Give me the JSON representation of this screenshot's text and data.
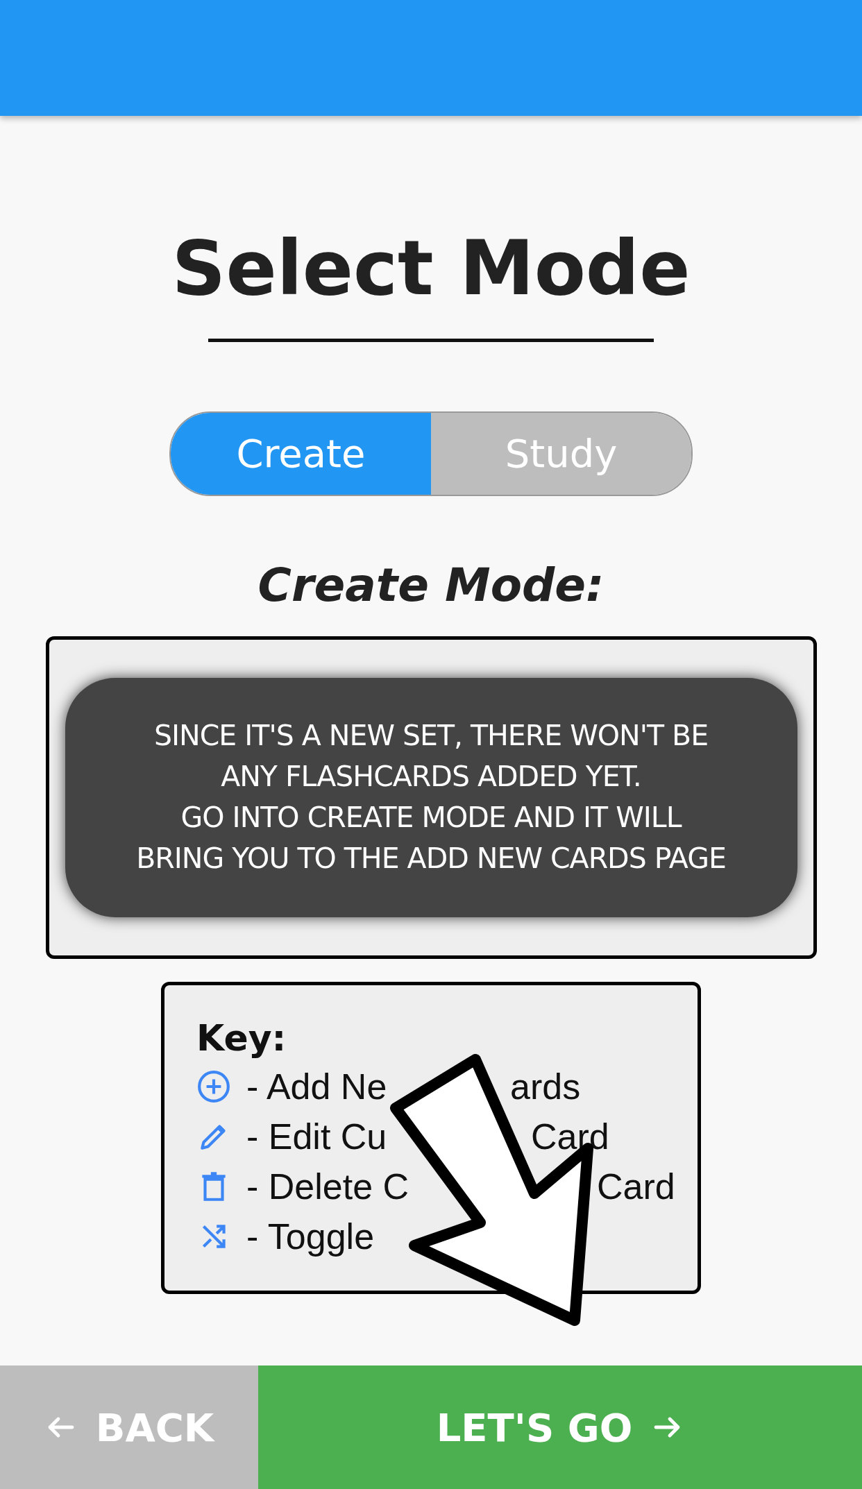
{
  "title": "Select Mode",
  "mode_toggle": [
    {
      "label": "Create",
      "selected": true
    },
    {
      "label": "Study",
      "selected": false
    }
  ],
  "mode_heading": "Create Mode:",
  "description_overlay": "SINCE IT'S A NEW SET, THERE WON'T BE\nANY FLASHCARDS ADDED YET.\nGO INTO CREATE MODE AND IT WILL\nBRING YOU TO THE ADD NEW CARDS PAGE",
  "key": {
    "title": "Key:",
    "items": [
      {
        "kind": "add",
        "parts": [
          "- Add Ne",
          "ards"
        ]
      },
      {
        "kind": "edit",
        "parts": [
          "- Edit Cu",
          "Card"
        ]
      },
      {
        "kind": "delete",
        "parts": [
          "- Delete C",
          "Card"
        ]
      },
      {
        "kind": "shuffle",
        "parts": [
          "- Toggle"
        ]
      }
    ]
  },
  "footer": {
    "back": "BACK",
    "go": "LET'S GO"
  }
}
